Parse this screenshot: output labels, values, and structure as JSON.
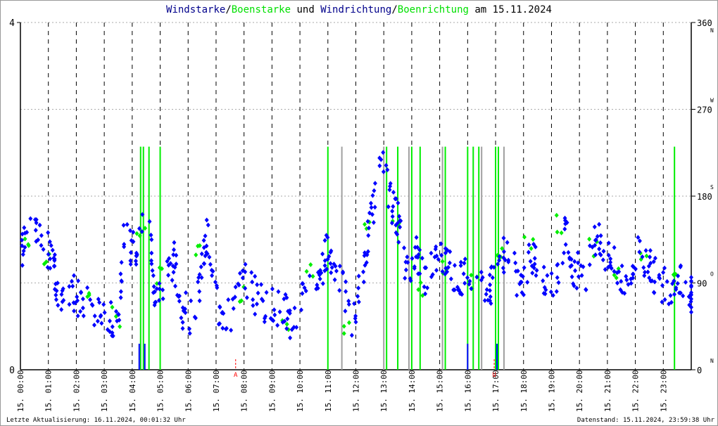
{
  "title": {
    "part1": "Windstarke",
    "sep1": "/",
    "part2": "Boenstarke",
    "mid": " und ",
    "part3": "Windrichtung",
    "sep2": "/",
    "part4": "Boenrichtung",
    "date": " am 15.11.2024"
  },
  "footer": {
    "updated": "Letzte Aktualisierung: 16.11.2024, 00:01:32 Uhr",
    "datastand": "Datenstand: 15.11.2024, 23:59:38 Uhr"
  },
  "colors": {
    "wind": "#0000ff",
    "gust": "#00ee00",
    "grey": "#a0a0a0",
    "marker": "#ff0000"
  },
  "chart_data": {
    "type": "scatter",
    "title": "Windstarke/Boenstarke und Windrichtung/Boenrichtung am 15.11.2024",
    "x_range_hours": [
      0,
      24
    ],
    "x_tick_labels": [
      "15. 00:00",
      "15. 01:00",
      "15. 02:00",
      "15. 03:00",
      "15. 04:00",
      "15. 05:00",
      "15. 06:00",
      "15. 07:00",
      "15. 08:00",
      "15. 09:00",
      "15. 10:00",
      "15. 11:00",
      "15. 12:00",
      "15. 13:00",
      "15. 14:00",
      "15. 15:00",
      "15. 16:00",
      "15. 17:00",
      "15. 18:00",
      "15. 19:00",
      "15. 20:00",
      "15. 21:00",
      "15. 22:00",
      "15. 23:00"
    ],
    "left_axis": {
      "range": [
        0,
        4
      ],
      "ticks": [
        "0",
        "4"
      ]
    },
    "right_axis": {
      "range": [
        0,
        360
      ],
      "ticks": [
        {
          "v": 0,
          "label": "0",
          "dir": "N"
        },
        {
          "v": 90,
          "label": "90",
          "dir": "O"
        },
        {
          "v": 180,
          "label": "180",
          "dir": "S"
        },
        {
          "v": 270,
          "label": "270",
          "dir": "W"
        },
        {
          "v": 360,
          "label": "360",
          "dir": "N"
        }
      ]
    },
    "markers": [
      {
        "hour": 7.7,
        "label": "A"
      },
      {
        "hour": 16.95,
        "label": "U"
      }
    ],
    "wind_direction": {
      "hours": [
        0.05,
        0.3,
        0.8,
        1.2,
        1.3,
        1.8,
        2.1,
        2.6,
        3.1,
        3.5,
        3.7,
        4.1,
        4.6,
        4.8,
        5.2,
        5.5,
        5.8,
        6.2,
        6.5,
        6.7,
        7.1,
        7.5,
        8.0,
        8.4,
        8.9,
        9.4,
        9.7,
        10.3,
        10.8,
        11.0,
        11.4,
        11.9,
        12.3,
        12.5,
        12.9,
        13.3,
        13.5,
        13.8,
        14.2,
        14.5,
        14.9,
        15.3,
        15.7,
        16.0,
        16.7,
        16.9,
        17.4,
        17.9,
        18.3,
        18.7,
        19.2,
        19.5,
        19.8,
        20.2,
        20.6,
        21.0,
        21.3,
        21.7,
        22.1,
        22.5,
        22.8,
        23.2,
        23.6,
        24.0
      ],
      "values": [
        124,
        142,
        131,
        113,
        80,
        84,
        73,
        62,
        47,
        58,
        138,
        120,
        164,
        69,
        98,
        113,
        62,
        55,
        106,
        142,
        62,
        53,
        98,
        77,
        66,
        66,
        47,
        84,
        106,
        128,
        95,
        47,
        113,
        149,
        215,
        171,
        157,
        106,
        120,
        91,
        120,
        113,
        91,
        106,
        84,
        91,
        128,
        84,
        120,
        91,
        95,
        142,
        106,
        98,
        142,
        113,
        106,
        87,
        120,
        109,
        91,
        87,
        98,
        77
      ]
    },
    "gust_direction": {
      "hours": [
        0.3,
        1.0,
        2.4,
        3.4,
        4.3,
        5.0,
        6.4,
        8.0,
        9.5,
        10.4,
        11.6,
        12.4,
        13.4,
        14.3,
        15.2,
        16.3,
        17.2,
        18.2,
        19.3,
        20.5,
        21.4,
        22.3,
        23.4
      ],
      "values": [
        130,
        118,
        70,
        55,
        140,
        100,
        125,
        80,
        45,
        100,
        45,
        145,
        160,
        80,
        110,
        95,
        125,
        130,
        150,
        125,
        95,
        110,
        90
      ]
    },
    "gust_speed_bars": {
      "hours": [
        4.3,
        4.4,
        4.6,
        5.0,
        11.0,
        13.1,
        13.5,
        14.0,
        14.3,
        15.2,
        16.0,
        16.2,
        16.4,
        17.0,
        17.1,
        23.4
      ],
      "values": [
        2.57,
        2.57,
        2.57,
        2.57,
        2.57,
        2.57,
        2.57,
        2.57,
        2.57,
        2.57,
        2.57,
        2.57,
        2.57,
        2.57,
        2.57,
        2.57
      ]
    },
    "grey_bars": {
      "hours": [
        11.5,
        13.0,
        13.9,
        15.1,
        16.5,
        17.3
      ],
      "values": [
        2.57,
        2.57,
        2.57,
        2.57,
        2.57,
        2.57
      ]
    },
    "wind_speed_bars": {
      "hours": [
        4.25,
        4.45,
        16.0,
        17.05
      ],
      "values": [
        0.3,
        0.3,
        0.3,
        0.3
      ]
    }
  }
}
